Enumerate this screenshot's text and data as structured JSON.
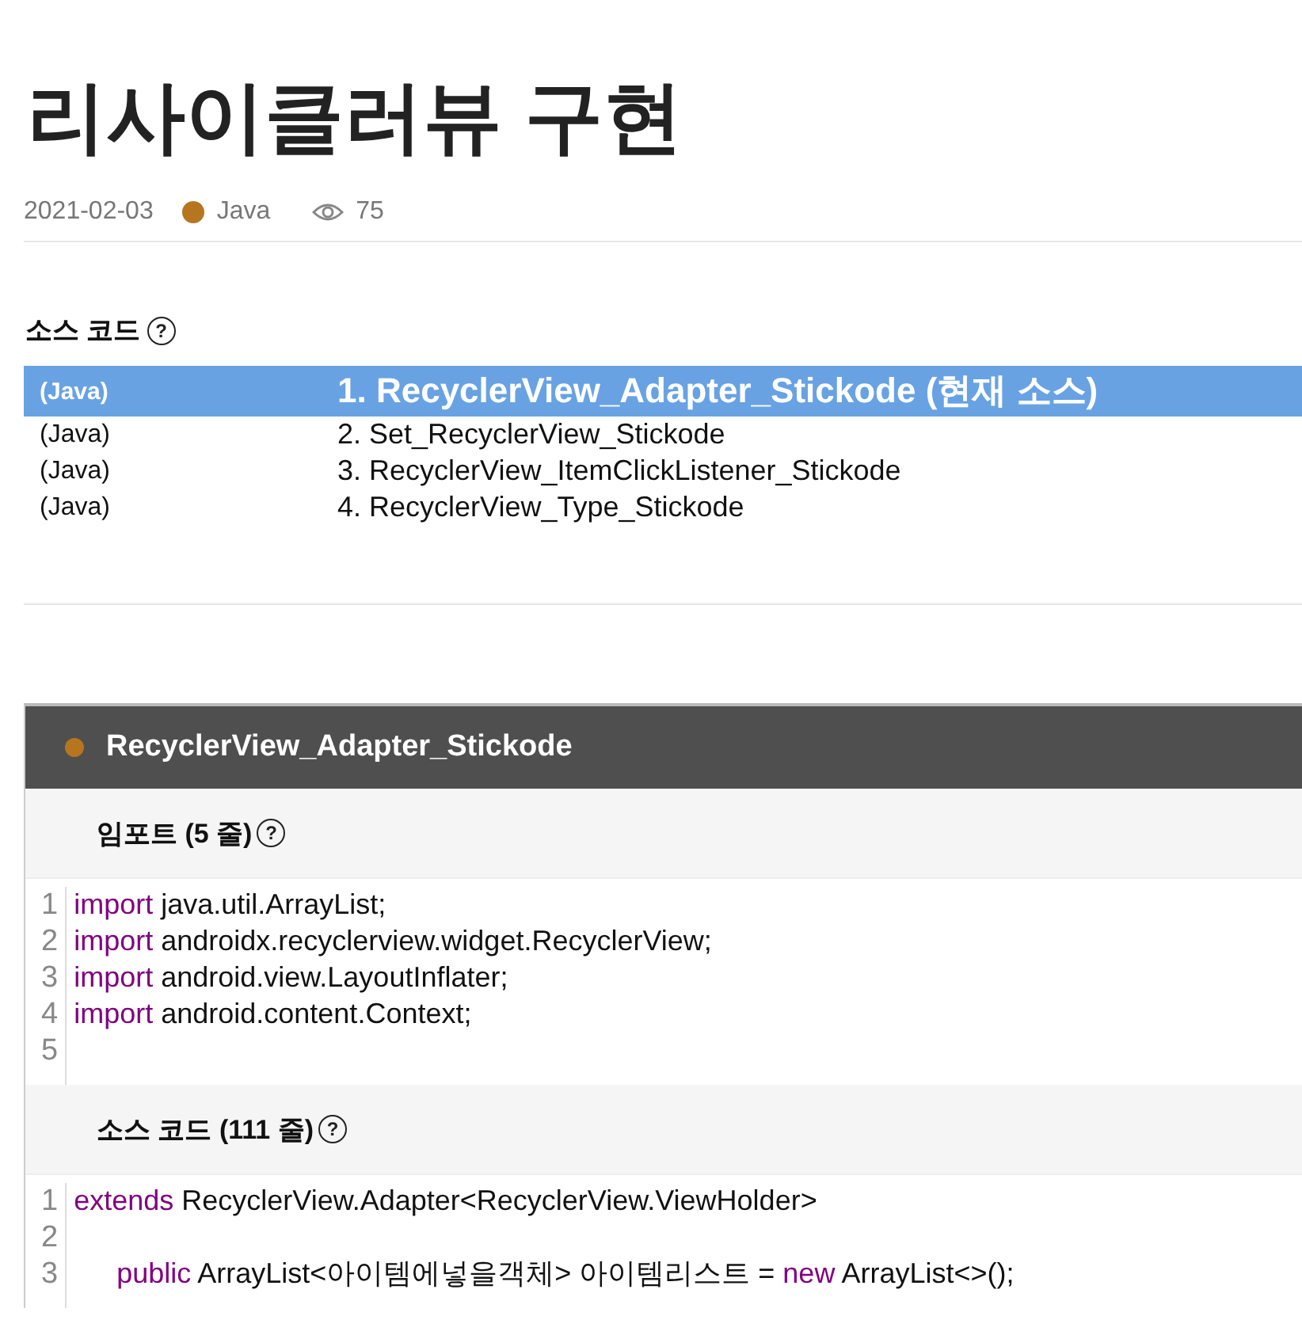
{
  "title": "리사이클러뷰 구현",
  "meta": {
    "date": "2021-02-03",
    "category": "Java",
    "views": "75"
  },
  "source_list": {
    "heading": "소스 코드",
    "help": "?",
    "items": [
      {
        "lang": "(Java)",
        "title": "1. RecyclerView_Adapter_Stickode (현재 소스)",
        "selected": true
      },
      {
        "lang": "(Java)",
        "title": "2. Set_RecyclerView_Stickode",
        "selected": false
      },
      {
        "lang": "(Java)",
        "title": "3. RecyclerView_ItemClickListener_Stickode",
        "selected": false
      },
      {
        "lang": "(Java)",
        "title": "4. RecyclerView_Type_Stickode",
        "selected": false
      }
    ]
  },
  "code_card": {
    "title": "RecyclerView_Adapter_Stickode",
    "sections": [
      {
        "heading": "임포트 (5 줄)",
        "help": "?",
        "lines": [
          {
            "number": "1",
            "tokens": [
              {
                "text": "import",
                "kind": "keyword"
              },
              {
                "text": " java.util.ArrayList;",
                "kind": "plain"
              }
            ]
          },
          {
            "number": "2",
            "tokens": [
              {
                "text": "import",
                "kind": "keyword"
              },
              {
                "text": " androidx.recyclerview.widget.RecyclerView;",
                "kind": "plain"
              }
            ]
          },
          {
            "number": "3",
            "tokens": [
              {
                "text": "import",
                "kind": "keyword"
              },
              {
                "text": " android.view.LayoutInflater;",
                "kind": "plain"
              }
            ]
          },
          {
            "number": "4",
            "tokens": [
              {
                "text": "import",
                "kind": "keyword"
              },
              {
                "text": " android.content.Context;",
                "kind": "plain"
              }
            ]
          },
          {
            "number": "5"
          }
        ]
      },
      {
        "heading": "소스 코드 (111 줄)",
        "help": "?",
        "lines": [
          {
            "number": "1",
            "tokens": [
              {
                "text": "extends",
                "kind": "keyword"
              },
              {
                "text": " RecyclerView.Adapter<RecyclerView.ViewHolder>",
                "kind": "plain"
              }
            ]
          },
          {
            "number": "2"
          },
          {
            "number": "3",
            "indented": true,
            "tokens": [
              {
                "text": "public",
                "kind": "keyword"
              },
              {
                "text": " ArrayList<아이템에넣을객체> 아이템리스트 = ",
                "kind": "plain"
              },
              {
                "text": "new",
                "kind": "keyword"
              },
              {
                "text": " ArrayList<>();",
                "kind": "plain"
              }
            ]
          }
        ]
      }
    ]
  }
}
